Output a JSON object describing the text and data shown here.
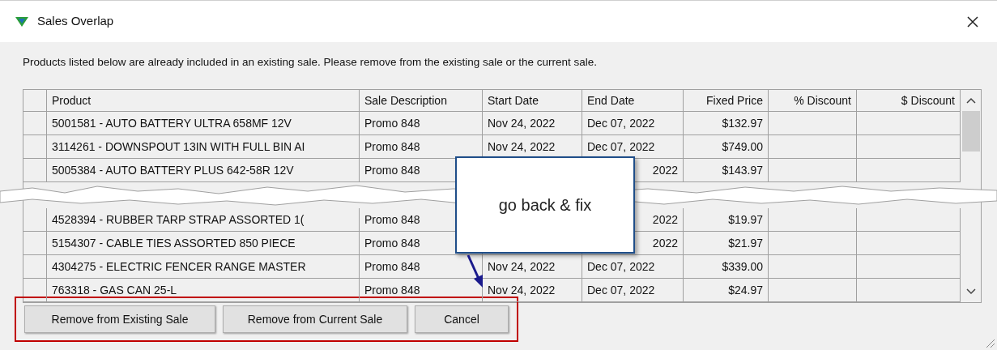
{
  "window": {
    "title": "Sales Overlap"
  },
  "message": "Products listed below are already included in an existing sale. Please remove from the existing sale or the current sale.",
  "table": {
    "columns": [
      "Product",
      "Sale Description",
      "Start Date",
      "End Date",
      "Fixed Price",
      "% Discount",
      "$ Discount"
    ],
    "rows": [
      {
        "kind": "row",
        "cells": [
          "5001581 - AUTO BATTERY ULTRA 658MF 12V",
          "Promo 848",
          "Nov 24, 2022",
          "Dec 07, 2022",
          "$132.97"
        ]
      },
      {
        "kind": "row",
        "cells": [
          "3114261 - DOWNSPOUT 13IN WITH FULL BIN AI",
          "Promo 848",
          "Nov 24, 2022",
          "Dec 07, 2022",
          "$749.00"
        ]
      },
      {
        "kind": "covered",
        "cells": [
          "5005384 - AUTO BATTERY PLUS 642-58R 12V",
          "Promo 848",
          "",
          "2022",
          "$143.97"
        ]
      },
      {
        "kind": "tear"
      },
      {
        "kind": "covered",
        "cells": [
          "4528394 - RUBBER TARP STRAP ASSORTED 1(",
          "Promo 848",
          "",
          "2022",
          "$19.97"
        ]
      },
      {
        "kind": "covered",
        "cells": [
          "5154307 - CABLE TIES ASSORTED 850 PIECE",
          "Promo 848",
          "",
          "2022",
          "$21.97"
        ]
      },
      {
        "kind": "row",
        "cells": [
          "4304275 - ELECTRIC FENCER RANGE MASTER",
          "Promo 848",
          "Nov 24, 2022",
          "Dec 07, 2022",
          "$339.00"
        ]
      },
      {
        "kind": "row",
        "cells": [
          "763318 - GAS CAN 25-L",
          "Promo 848",
          "Nov 24, 2022",
          "Dec 07, 2022",
          "$24.97"
        ]
      }
    ]
  },
  "buttons": [
    "Remove from Existing Sale",
    "Remove from Current Sale",
    "Cancel"
  ],
  "callout": {
    "text": "go back & fix"
  }
}
